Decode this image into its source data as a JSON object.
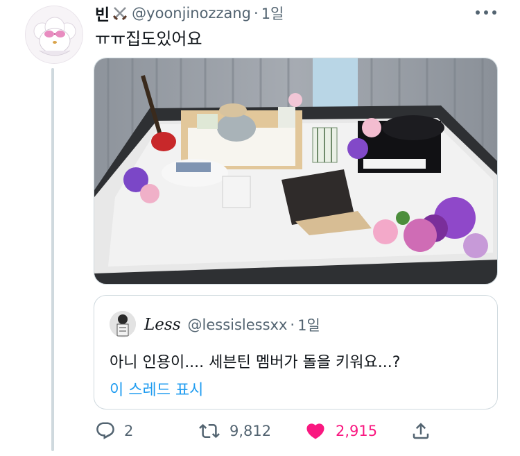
{
  "tweet": {
    "display_name": "빈",
    "name_icon": "crossed-swords-icon",
    "handle": "@yoonjinozzang",
    "separator": "·",
    "time": "1일",
    "text": "ㅠㅠ집도있어요",
    "avatar_icon": "cartoon-avatar",
    "media_alt": "photo"
  },
  "quote": {
    "name": "Less",
    "handle": "@lessislessxx",
    "separator": "·",
    "time": "1일",
    "text": "아니 인용이.... 세븐틴 멤버가 돌을 키워요...?",
    "show_thread": "이 스레드 표시"
  },
  "actions": {
    "reply_count": "2",
    "retweet_count": "9,812",
    "like_count": "2,915",
    "icons": [
      "reply-icon",
      "retweet-icon",
      "like-icon",
      "share-icon"
    ]
  },
  "colors": {
    "accent": "#1d9bf0",
    "like": "#f91880",
    "muted": "#536471",
    "border": "#cfd9de"
  }
}
